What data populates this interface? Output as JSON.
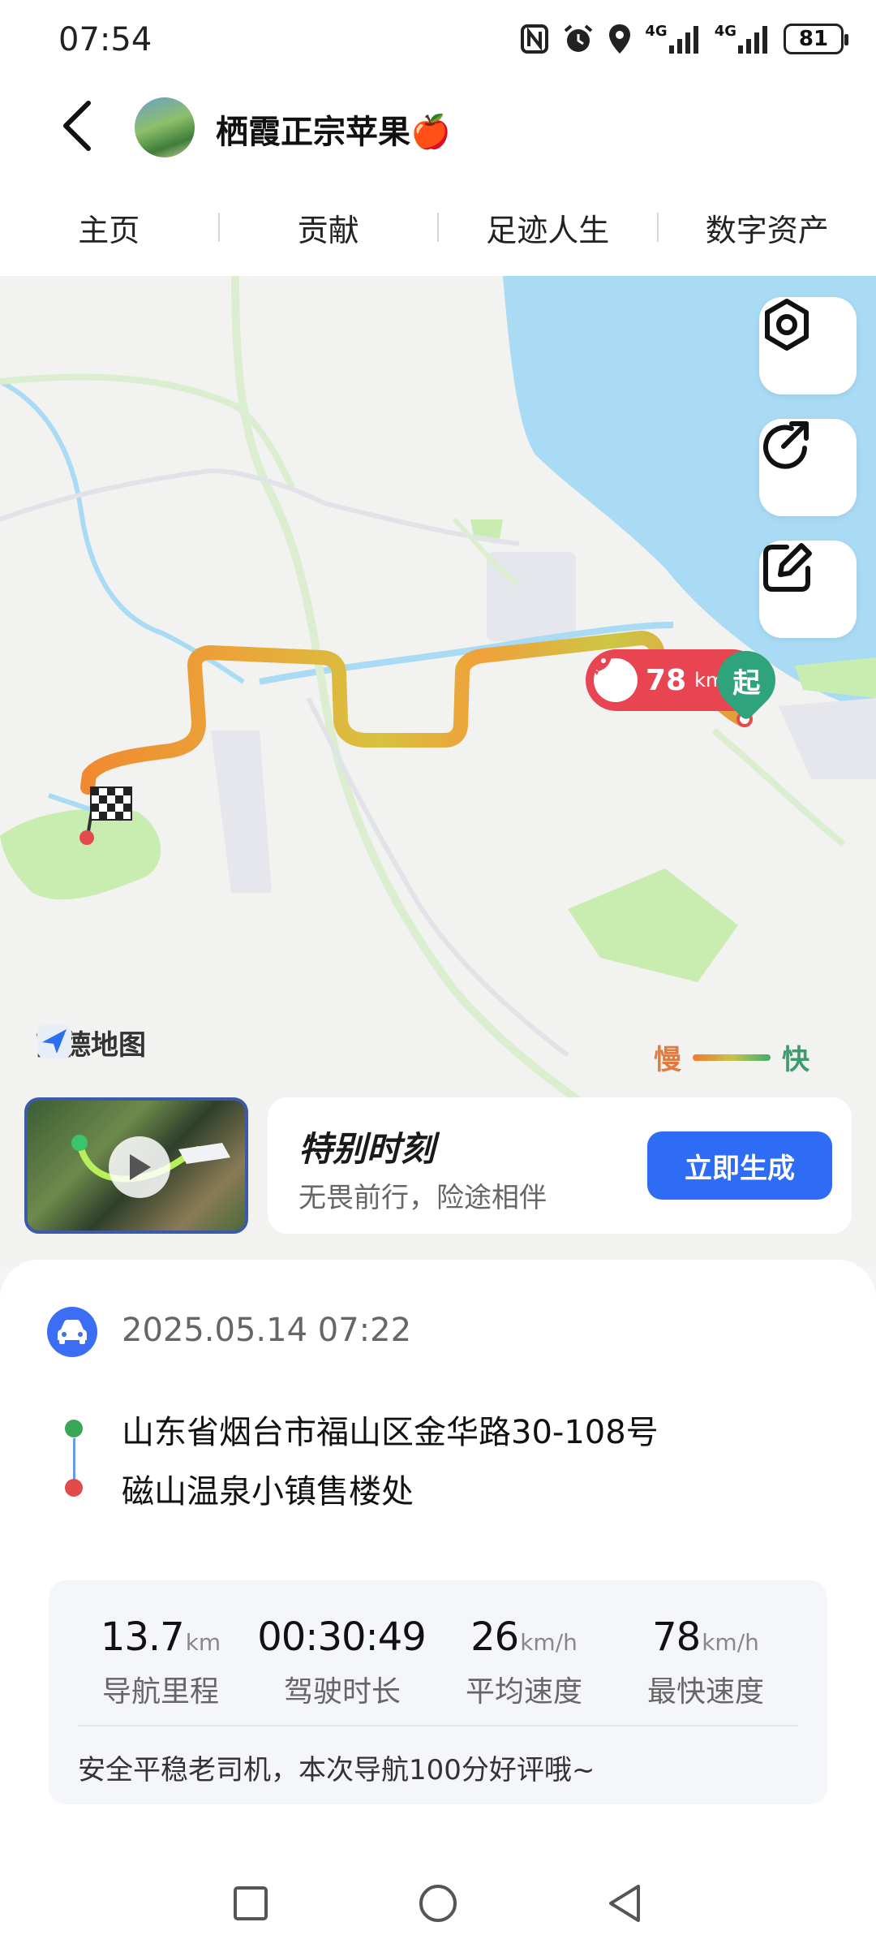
{
  "status_bar": {
    "time": "07:54",
    "net1": "4G",
    "net2": "4G",
    "battery": "81"
  },
  "header": {
    "username": "栖霞正宗苹果🍎"
  },
  "tabs": [
    {
      "label": "主页"
    },
    {
      "label": "贡献"
    },
    {
      "label": "足迹人生"
    },
    {
      "label": "数字资产"
    }
  ],
  "map": {
    "provider": "高德地图",
    "legend_slow": "慢",
    "legend_fast": "快",
    "max_speed_value": "78",
    "max_speed_unit": "km/h",
    "start_label": "起",
    "icons": [
      "settings-icon",
      "share-icon",
      "edit-icon",
      "checkered-flag-icon",
      "rocket-icon"
    ]
  },
  "special_moment": {
    "title": "特别时刻",
    "subtitle": "无畏前行，险途相伴",
    "button": "立即生成"
  },
  "trip": {
    "datetime": "2025.05.14 07:22",
    "start_address": "山东省烟台市福山区金华路30-108号",
    "end_address": "磁山温泉小镇售楼处",
    "stats": [
      {
        "value": "13.7",
        "unit": "km",
        "label": "导航里程"
      },
      {
        "value": "00:30:49",
        "unit": "",
        "label": "驾驶时长"
      },
      {
        "value": "26",
        "unit": "km/h",
        "label": "平均速度"
      },
      {
        "value": "78",
        "unit": "km/h",
        "label": "最快速度"
      }
    ],
    "note": "安全平稳老司机，本次导航100分好评哦~"
  },
  "colors": {
    "accent_blue": "#2e6cf6",
    "speed_badge": "#e84452",
    "start_pin": "#2fa37b",
    "route_start_dot": "#3aa65a",
    "route_end_dot": "#e24b4b"
  }
}
